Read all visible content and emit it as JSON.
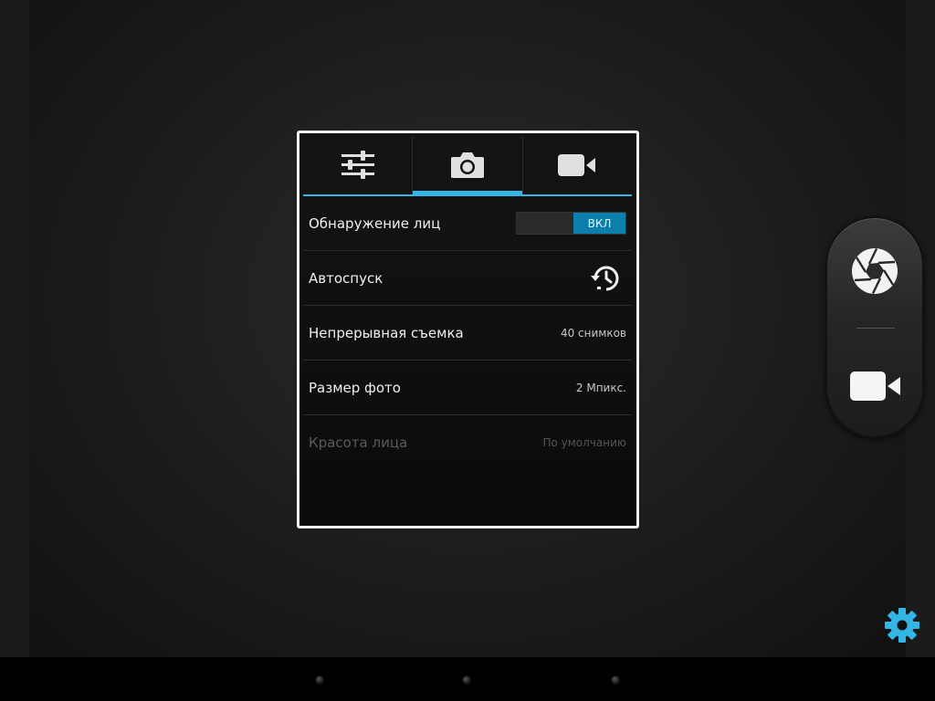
{
  "camera": {
    "tabs": [
      {
        "icon": "sliders-icon",
        "active": false
      },
      {
        "icon": "camera-icon",
        "active": true
      },
      {
        "icon": "video-camera-icon",
        "active": false
      }
    ],
    "settings": {
      "face_detection": {
        "label": "Обнаружение лиц",
        "toggle_on_label": "ВКЛ",
        "enabled": true
      },
      "self_timer": {
        "label": "Автоспуск",
        "icon": "timer-icon"
      },
      "burst_shot": {
        "label": "Непрерывная съемка",
        "value": "40 снимков"
      },
      "photo_size": {
        "label": "Размер фото",
        "value": "2 Мпикс."
      },
      "face_beauty": {
        "label": "Красота лица",
        "value": "По умолчанию",
        "disabled": true
      }
    }
  },
  "shutter_controls": {
    "photo_icon": "aperture-icon",
    "video_icon": "video-camera-icon"
  },
  "colors": {
    "accent": "#33b5e5",
    "toggle_on": "#0d7fab",
    "settings_gear": "#33b5e5"
  }
}
